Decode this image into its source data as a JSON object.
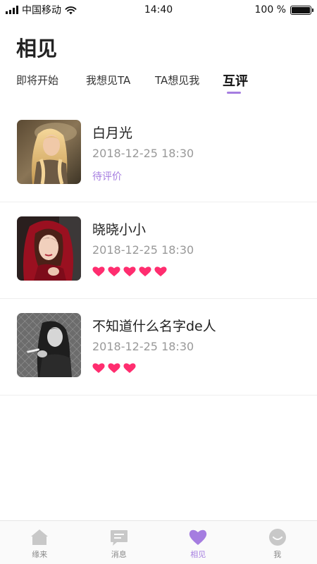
{
  "status_bar": {
    "carrier": "中国移动",
    "time": "14:40",
    "battery": "100 %",
    "battery_level": 1.0
  },
  "header": {
    "title": "相见"
  },
  "tabs": [
    {
      "label": "即将开始",
      "active": false
    },
    {
      "label": "我想见TA",
      "active": false
    },
    {
      "label": "TA想见我",
      "active": false
    },
    {
      "label": "互评",
      "active": true
    }
  ],
  "items": [
    {
      "name": "白月光",
      "time": "2018-12-25 18:30",
      "status": "待评价",
      "hearts": 0,
      "avatar": "blonde-woman-photo"
    },
    {
      "name": "晓晓小小",
      "time": "2018-12-25 18:30",
      "status": "",
      "hearts": 5,
      "avatar": "red-hood-woman-photo"
    },
    {
      "name": "不知道什么名字de人",
      "time": "2018-12-25 18:30",
      "status": "",
      "hearts": 3,
      "avatar": "bw-woman-photo"
    }
  ],
  "tabbar": [
    {
      "label": "缘来",
      "icon": "home-icon",
      "active": false
    },
    {
      "label": "消息",
      "icon": "message-icon",
      "active": false
    },
    {
      "label": "相见",
      "icon": "heart-icon",
      "active": true
    },
    {
      "label": "我",
      "icon": "profile-face-icon",
      "active": false
    }
  ],
  "colors": {
    "accent": "#a57de0",
    "heart": "#ff2d6f",
    "muted": "#999999"
  }
}
